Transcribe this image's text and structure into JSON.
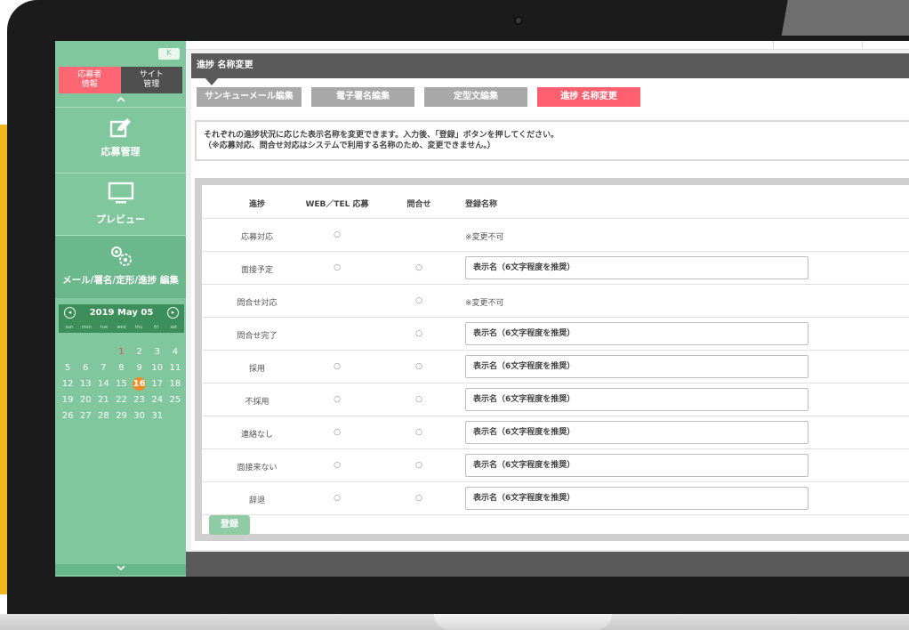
{
  "sidebar": {
    "collapse_label": "K",
    "tabs": [
      {
        "label": "応募者\n情報"
      },
      {
        "label": "サイト\n管理"
      }
    ],
    "up_arrow": "⌃",
    "down_arrow": "⌄",
    "nav": [
      {
        "label": "応募管理",
        "icon": "edit-icon"
      },
      {
        "label": "プレビュー",
        "icon": "monitor-icon"
      },
      {
        "label": "メール/署名/定形/進捗 編集",
        "icon": "gears-icon"
      }
    ],
    "calendar": {
      "title": "2019 May 05",
      "prev_icon": "◂",
      "next_icon": "▸",
      "dows": [
        "sun",
        "mon",
        "tue",
        "wed",
        "thu",
        "fri",
        "sat"
      ],
      "weeks": [
        [
          "",
          "",
          "",
          "1",
          "2",
          "3",
          "4"
        ],
        [
          "5",
          "6",
          "7",
          "8",
          "9",
          "10",
          "11"
        ],
        [
          "12",
          "13",
          "14",
          "15",
          "16",
          "17",
          "18"
        ],
        [
          "19",
          "20",
          "21",
          "22",
          "23",
          "24",
          "25"
        ],
        [
          "26",
          "27",
          "28",
          "29",
          "30",
          "31",
          ""
        ]
      ],
      "red_day": "1",
      "today": "16"
    }
  },
  "header": {
    "title": "進捗 名称変更"
  },
  "subtabs": [
    {
      "label": "サンキューメール編集",
      "active": false
    },
    {
      "label": "電子署名編集",
      "active": false
    },
    {
      "label": "定型文編集",
      "active": false
    },
    {
      "label": "進捗 名称変更",
      "active": true
    }
  ],
  "notice": {
    "line1": "それぞれの進捗状況に応じた表示名称を変更できます。入力後、「登録」ボタンを押してください。",
    "line2": "（※応募対応、問合せ対応はシステムで利用する名称のため、変更できません。）"
  },
  "table": {
    "headers": [
      "進捗",
      "WEB／TEL 応募",
      "問合せ",
      "登録名称"
    ],
    "rows": [
      {
        "name": "応募対応",
        "web": "○",
        "inquiry": "",
        "value": "※変更不可",
        "editable": false
      },
      {
        "name": "面接予定",
        "web": "○",
        "inquiry": "○",
        "value": "表示名（6文字程度を推奨）",
        "editable": true
      },
      {
        "name": "問合せ対応",
        "web": "",
        "inquiry": "○",
        "value": "※変更不可",
        "editable": false
      },
      {
        "name": "問合せ完了",
        "web": "",
        "inquiry": "○",
        "value": "表示名（6文字程度を推奨）",
        "editable": true
      },
      {
        "name": "採用",
        "web": "○",
        "inquiry": "○",
        "value": "表示名（6文字程度を推奨）",
        "editable": true
      },
      {
        "name": "不採用",
        "web": "○",
        "inquiry": "○",
        "value": "表示名（6文字程度を推奨）",
        "editable": true
      },
      {
        "name": "連絡なし",
        "web": "○",
        "inquiry": "○",
        "value": "表示名（6文字程度を推奨）",
        "editable": true
      },
      {
        "name": "面接来ない",
        "web": "○",
        "inquiry": "○",
        "value": "表示名（6文字程度を推奨）",
        "editable": true
      },
      {
        "name": "辞退",
        "web": "○",
        "inquiry": "○",
        "value": "表示名（6文字程度を推奨）",
        "editable": true
      }
    ],
    "submit_label": "登録"
  },
  "colors": {
    "sidebar": "#80c79d",
    "accent": "#ff6070",
    "header": "#5a5a5a",
    "today": "#f28a25"
  }
}
